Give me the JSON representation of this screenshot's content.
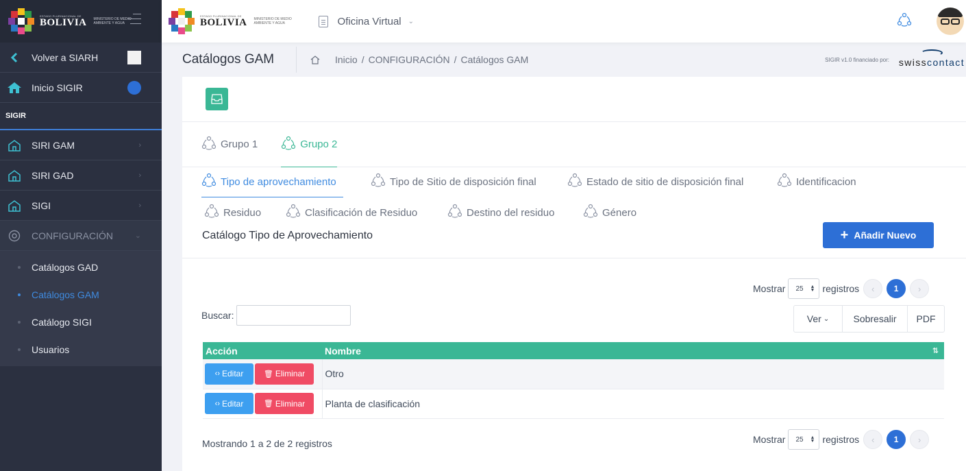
{
  "sidebar": {
    "logo": {
      "small": "ESTADO PLURINACIONAL DE",
      "big": "BOLIVIA",
      "ministry": "MINISTERIO DE MEDIO AMBIENTE Y AGUA"
    },
    "back": {
      "label": "Volver a SIARH"
    },
    "home": {
      "label": "Inicio SIGIR"
    },
    "section": "SIGIR",
    "items": [
      {
        "label": "SIRI GAM"
      },
      {
        "label": "SIRI GAD"
      },
      {
        "label": "SIGI"
      }
    ],
    "config": {
      "label": "CONFIGURACIÓN"
    },
    "sub": [
      {
        "label": "Catálogos GAD"
      },
      {
        "label": "Catálogos GAM"
      },
      {
        "label": "Catálogo SIGI"
      },
      {
        "label": "Usuarios"
      }
    ]
  },
  "topbar": {
    "logo": {
      "small": "ESTADO PLURINACIONAL DE",
      "big": "BOLIVIA",
      "ministry": "MINISTERIO DE MEDIO AMBIENTE Y AGUA"
    },
    "office": "Oficina Virtual"
  },
  "header": {
    "title": "Catálogos GAM",
    "breadcrumb": [
      "Inicio",
      "/",
      "CONFIGURACIÓN",
      "/",
      "Catálogos GAM"
    ],
    "financed": "SIGIR v1.0 financiado por:",
    "sponsor_a": "swiss",
    "sponsor_b": "contact"
  },
  "groups": [
    "Grupo 1",
    "Grupo 2"
  ],
  "subtabs": [
    "Tipo de aprovechamiento",
    "Tipo de Sitio de disposición final",
    "Estado de sitio de disposición final",
    "Identificacion",
    "Residuo",
    "Clasificación de Residuo",
    "Destino del residuo",
    "Género"
  ],
  "catalog": {
    "title": "Catálogo Tipo de Aprovechamiento",
    "add_label": "Añadir Nuevo"
  },
  "controls": {
    "show": "Mostrar",
    "page_size": "25",
    "records": "registros",
    "prev": "‹",
    "next": "›",
    "page": "1",
    "search_label": "Buscar:",
    "buttons": [
      "Ver",
      "Sobresalir",
      "PDF"
    ]
  },
  "table": {
    "headers": [
      "Acción",
      "Nombre"
    ],
    "edit": "Editar",
    "delete": "Eliminar",
    "rows": [
      {
        "name": "Otro"
      },
      {
        "name": "Planta de clasificación"
      }
    ]
  },
  "footer": {
    "info": "Mostrando 1 a 2 de 2 registros"
  },
  "colors": {
    "sidebar": "#2b3040",
    "accent_green": "#3ab795",
    "accent_blue": "#2d6fd6",
    "danger": "#f04b64",
    "edit": "#3d9ff0"
  }
}
